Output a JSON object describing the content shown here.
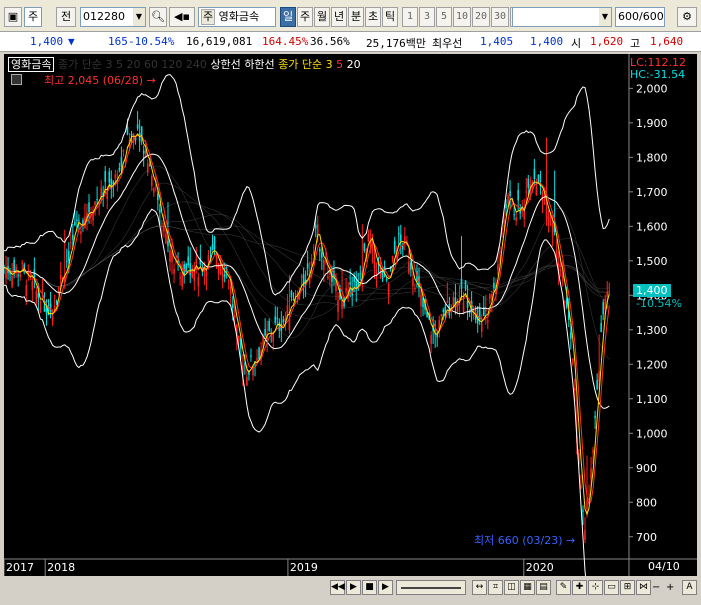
{
  "toolbar": {
    "market": "주",
    "prev_label": "전",
    "code": "012280",
    "stock_name": "영화금속",
    "stock_prefix": "주",
    "periods": [
      "일",
      "주",
      "월",
      "년",
      "분",
      "초",
      "틱"
    ],
    "active_period": "일",
    "intervals": [
      "1",
      "3",
      "5",
      "10",
      "20",
      "30",
      "60",
      "120"
    ],
    "count_value": "600",
    "count_total": "/600"
  },
  "quote": {
    "price": "1,400",
    "change": "165",
    "change_pct": "-10.54%",
    "volume": "16,619,081",
    "volume_ratio": "164.45%",
    "turnover": "36.56%",
    "amount": "25,176백만",
    "best_label": "최우선",
    "best_ask": "1,405",
    "best_bid": "1,400",
    "open_label": "시",
    "open": "1,620",
    "high_label": "고",
    "high": "1,640"
  },
  "chart": {
    "tab_label": "영화금속",
    "legend_faded": "종가 단순 3 5 20 60 120 240",
    "legend_upper": "상한선",
    "legend_lower": "하한선",
    "legend_ma_label": "종가 단순",
    "ma3_label": "3",
    "ma5_label": "5",
    "ma20_label": "20",
    "lc_label": "LC:112.12",
    "hc_label": "HC:-31.54",
    "high_annotation": "최고 2,045 (06/28) →",
    "low_annotation": "최저 660 (03/23) →",
    "current_price_tag": "1,400",
    "current_change_tag": "-10.54%",
    "right_date": "04/10",
    "colors": {
      "ma3": "#ffe000",
      "ma5": "#ff3030",
      "ma20": "#ffffff",
      "up": "#ff2020",
      "down": "#00e0e0"
    }
  },
  "chart_data": {
    "type": "candlestick",
    "y_ticks": [
      700,
      800,
      900,
      1000,
      1100,
      1200,
      1300,
      1400,
      1500,
      1600,
      1700,
      1800,
      1900,
      2000
    ],
    "ylim": [
      650,
      2030
    ],
    "x_labels": [
      {
        "label": "2017",
        "t": 0.0
      },
      {
        "label": "2018",
        "t": 0.066
      },
      {
        "label": "2019",
        "t": 0.455
      },
      {
        "label": "2020",
        "t": 0.833
      }
    ],
    "close_profile": [
      [
        0.0,
        1480
      ],
      [
        0.03,
        1470
      ],
      [
        0.055,
        1400
      ],
      [
        0.075,
        1350
      ],
      [
        0.09,
        1440
      ],
      [
        0.11,
        1560
      ],
      [
        0.13,
        1640
      ],
      [
        0.16,
        1700
      ],
      [
        0.185,
        1760
      ],
      [
        0.2,
        1850
      ],
      [
        0.215,
        1890
      ],
      [
        0.23,
        1800
      ],
      [
        0.245,
        1700
      ],
      [
        0.26,
        1560
      ],
      [
        0.275,
        1480
      ],
      [
        0.3,
        1470
      ],
      [
        0.32,
        1490
      ],
      [
        0.34,
        1520
      ],
      [
        0.36,
        1460
      ],
      [
        0.375,
        1260
      ],
      [
        0.39,
        1180
      ],
      [
        0.41,
        1240
      ],
      [
        0.43,
        1300
      ],
      [
        0.45,
        1330
      ],
      [
        0.47,
        1400
      ],
      [
        0.49,
        1480
      ],
      [
        0.5,
        1600
      ],
      [
        0.515,
        1490
      ],
      [
        0.53,
        1420
      ],
      [
        0.55,
        1390
      ],
      [
        0.57,
        1450
      ],
      [
        0.585,
        1560
      ],
      [
        0.6,
        1480
      ],
      [
        0.615,
        1420
      ],
      [
        0.63,
        1560
      ],
      [
        0.645,
        1540
      ],
      [
        0.66,
        1440
      ],
      [
        0.675,
        1340
      ],
      [
        0.69,
        1280
      ],
      [
        0.71,
        1360
      ],
      [
        0.73,
        1410
      ],
      [
        0.75,
        1370
      ],
      [
        0.77,
        1320
      ],
      [
        0.79,
        1460
      ],
      [
        0.805,
        1680
      ],
      [
        0.82,
        1640
      ],
      [
        0.835,
        1660
      ],
      [
        0.85,
        1760
      ],
      [
        0.865,
        1680
      ],
      [
        0.88,
        1620
      ],
      [
        0.895,
        1450
      ],
      [
        0.91,
        1250
      ],
      [
        0.92,
        960
      ],
      [
        0.93,
        700
      ],
      [
        0.945,
        1000
      ],
      [
        0.96,
        1350
      ],
      [
        0.97,
        1400
      ]
    ]
  }
}
